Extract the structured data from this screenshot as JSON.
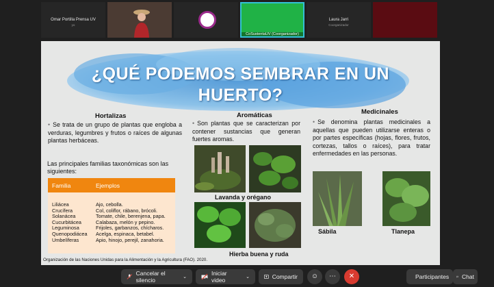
{
  "participants": [
    {
      "name": "Omar Portilla Prensa UV",
      "sub": "yo",
      "type": "name"
    },
    {
      "name": "",
      "sub": "",
      "type": "video"
    },
    {
      "name": "",
      "sub": "",
      "type": "logo"
    },
    {
      "name": "CoSustentaUV (Coorganizador)",
      "sub": "",
      "type": "green"
    },
    {
      "name": "Laura Jarri",
      "sub": "Coorganizador",
      "type": "name"
    },
    {
      "name": "",
      "sub": "",
      "type": "red"
    }
  ],
  "slide": {
    "title_line1": "¿QUÉ PODEMOS SEMBRAR EN UN",
    "title_line2": "HUERTO?",
    "col1_head": "Hortalizas",
    "col1_text": "Se trata de un grupo de plantas que engloba a verduras, legumbres y frutos o raíces de algunas plantas herbáceas.",
    "families_title": "Las principales familias taxonómicas son las siguientes:",
    "table_head": {
      "family": "Familia",
      "examples": "Ejemplos"
    },
    "families": [
      "Liliácea",
      "Crucífera",
      "Solanácea",
      "Cucurbitácea",
      "Leguminosa",
      "Quenopodiácea",
      "Umbelíferas"
    ],
    "examples": [
      "Ajo, cebolla.",
      "Col, coliflor, rábano, brócoli.",
      "Tomate, chile, berenjena, papa.",
      "Calabaza, melón y pepino.",
      "Frijoles, garbanzos, chícharos.",
      "Acelga, espinaca, betabel.",
      "Apio, hinojo, perejil, zanahoria."
    ],
    "col2_head": "Aromáticas",
    "col2_text": "Son plantas que se caracterizan por contener sustancias que generan fuertes aromas.",
    "cap_lavanda": "Lavanda y orégano",
    "cap_hierba": "Hierba buena y ruda",
    "col3_head": "Medicinales",
    "col3_text": "Se denomina plantas medicinales a aquellas que pueden utilizarse enteras o por partes específicas (hojas, flores, frutos, cortezas, tallos o raíces), para tratar enfermedades en las personas.",
    "cap_sabila": "Sábila",
    "cap_tlanepa": "Tlanepa",
    "source": "Organización de las Naciones Unidas para la Alimentación y la Agricultura (FAO).  2020."
  },
  "controls": {
    "mute": "Cancelar el silencio",
    "video": "Iniciar video",
    "share": "Compartir",
    "participants": "Participantes",
    "chat": "Chat"
  }
}
